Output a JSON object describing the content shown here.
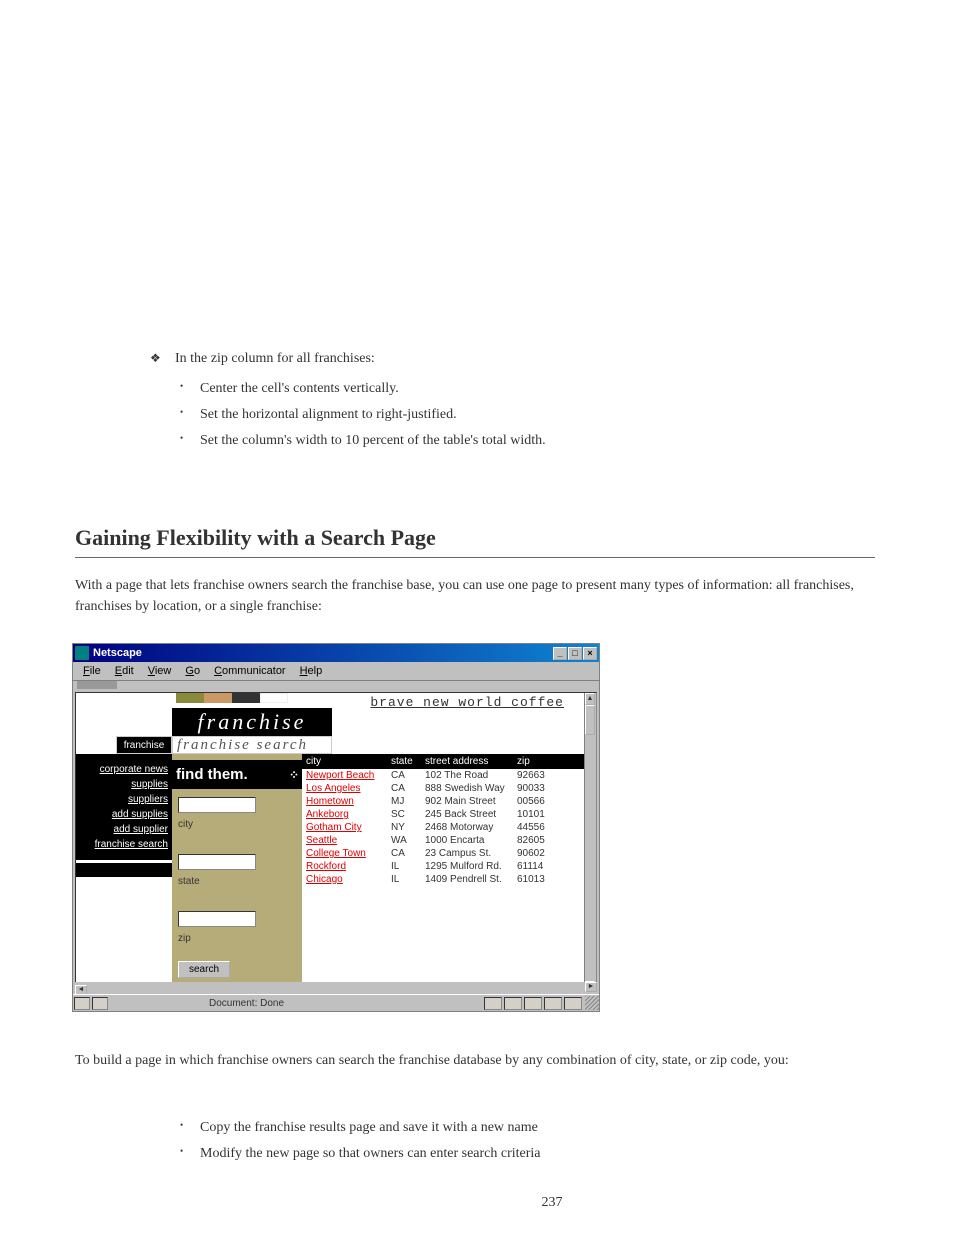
{
  "bullets": {
    "main": "In the zip column for all franchises:",
    "sub": [
      "Center the cell's contents vertically.",
      "Set the horizontal alignment to right-justified.",
      "Set the column's width to 10 percent of the table's total width."
    ]
  },
  "section": {
    "title": "Gaining Flexibility with a Search Page",
    "para": "With a page that lets franchise owners search the franchise base, you can use one page to present many types of information: all franchises, franchises by location, or a single franchise:"
  },
  "netscape": {
    "title": "Netscape",
    "menus": [
      "File",
      "Edit",
      "View",
      "Go",
      "Communicator",
      "Help"
    ],
    "brand": "brave new world coffee",
    "banner1": "franchise",
    "banner2": "franchise search",
    "franchise_label": "franchise",
    "leftnav": [
      "corporate news",
      "supplies",
      "suppliers",
      "add supplies",
      "add supplier",
      "franchise search"
    ],
    "search": {
      "findthem": "find them.",
      "city_label": "city",
      "state_label": "state",
      "zip_label": "zip",
      "button": "search"
    },
    "table": {
      "headers": [
        "city",
        "state",
        "street address",
        "zip"
      ],
      "rows": [
        {
          "city": "Newport Beach",
          "state": "CA",
          "addr": "102 The Road",
          "zip": "92663"
        },
        {
          "city": "Los Angeles",
          "state": "CA",
          "addr": "888 Swedish Way",
          "zip": "90033"
        },
        {
          "city": "Hometown",
          "state": "MJ",
          "addr": "902 Main Street",
          "zip": "00566"
        },
        {
          "city": "Ankeborg",
          "state": "SC",
          "addr": "245 Back Street",
          "zip": "10101"
        },
        {
          "city": "Gotham City",
          "state": "NY",
          "addr": "2468 Motorway",
          "zip": "44556"
        },
        {
          "city": "Seattle",
          "state": "WA",
          "addr": "1000 Encarta",
          "zip": "82605"
        },
        {
          "city": "College Town",
          "state": "CA",
          "addr": "23 Campus St.",
          "zip": "90602"
        },
        {
          "city": "Rockford",
          "state": "IL",
          "addr": "1295 Mulford Rd.",
          "zip": "61114"
        },
        {
          "city": "Chicago",
          "state": "IL",
          "addr": "1409 Pendrell St.",
          "zip": "61013"
        }
      ]
    },
    "status": "Document: Done"
  },
  "para_below": "To build a page in which franchise owners can search the franchise database by any combination of city, state, or zip code, you:",
  "list2": [
    "Copy the franchise results page and save it with a new name",
    "Modify the new page so that owners can enter search criteria"
  ],
  "page_number": "237"
}
